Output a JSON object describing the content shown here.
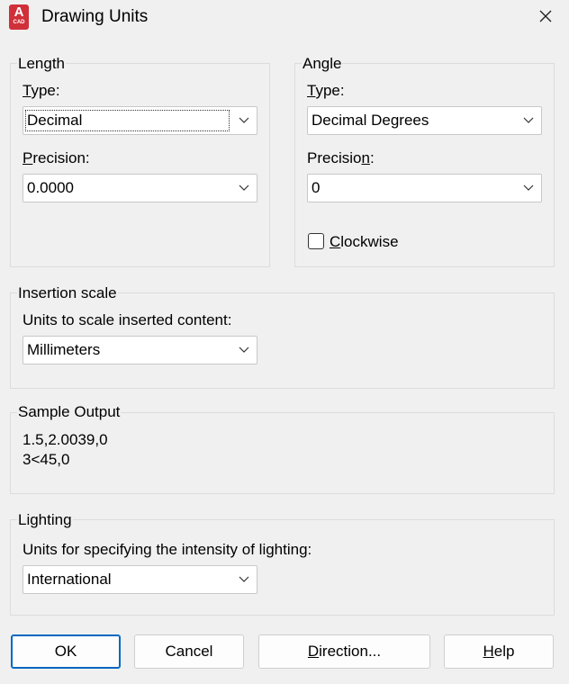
{
  "window": {
    "title": "Drawing Units",
    "app_icon": "autocad-icon",
    "app_icon_letter": "A",
    "app_icon_sub": "CAD"
  },
  "length": {
    "legend": "Length",
    "type_label": "Type:",
    "type_value": "Decimal",
    "precision_label": "Precision:",
    "precision_value": "0.0000"
  },
  "angle": {
    "legend": "Angle",
    "type_label": "Type:",
    "type_value": "Decimal Degrees",
    "precision_label": "Precision:",
    "precision_value": "0",
    "clockwise_label": "Clockwise",
    "clockwise_checked": false
  },
  "insertion": {
    "legend": "Insertion scale",
    "label": "Units to scale inserted content:",
    "value": "Millimeters"
  },
  "sample": {
    "legend": "Sample Output",
    "line1": "1.5,2.0039,0",
    "line2": "3<45,0"
  },
  "lighting": {
    "legend": "Lighting",
    "label": "Units for specifying the intensity of lighting:",
    "value": "International"
  },
  "buttons": {
    "ok": "OK",
    "cancel": "Cancel",
    "direction": "Direction...",
    "help": "Help"
  }
}
